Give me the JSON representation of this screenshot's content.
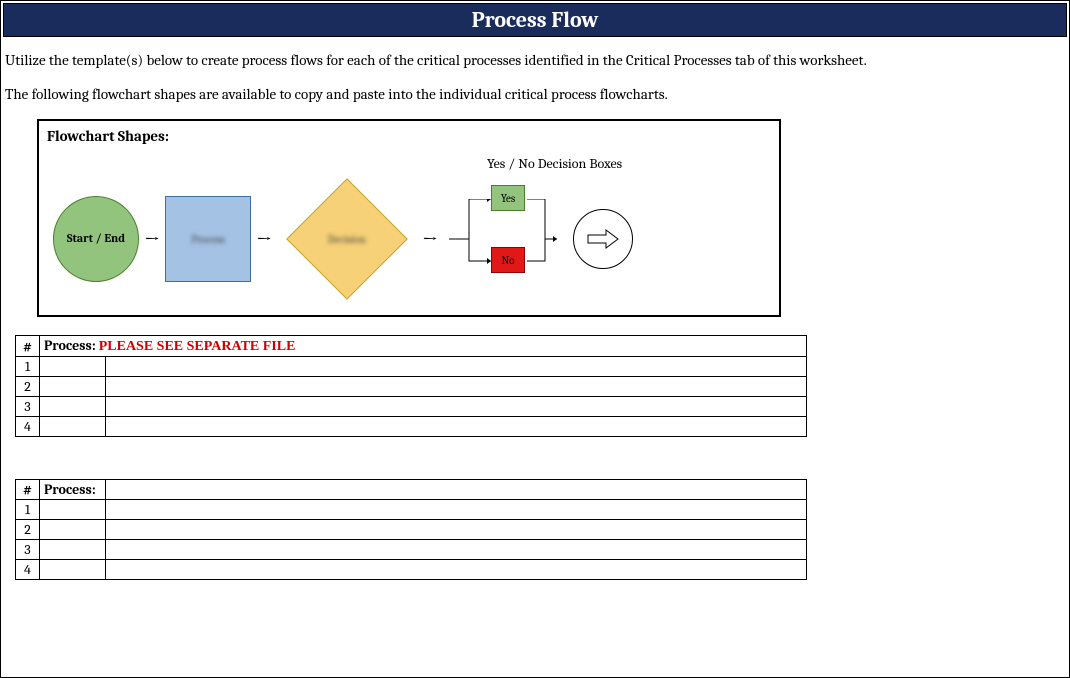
{
  "title": "Process Flow",
  "instruction1": "Utilize the template(s) below to create process flows for each of the critical processes identified in the Critical Processes tab of this worksheet.",
  "instruction2": "The following flowchart shapes are available to copy and paste into the individual critical process flowcharts.",
  "shapes_title": "Flowchart Shapes:",
  "decision_label": "Yes / No Decision Boxes",
  "start_end": "Start / End",
  "yes": "Yes",
  "no": "No",
  "table1": {
    "num_hdr": "#",
    "process_hdr": "Process:",
    "process_note": "PLEASE SEE SEPARATE FILE",
    "rows": [
      "1",
      "2",
      "3",
      "4"
    ]
  },
  "table2": {
    "num_hdr": "#",
    "process_hdr": "Process:",
    "rows": [
      "1",
      "2",
      "3",
      "4"
    ]
  }
}
